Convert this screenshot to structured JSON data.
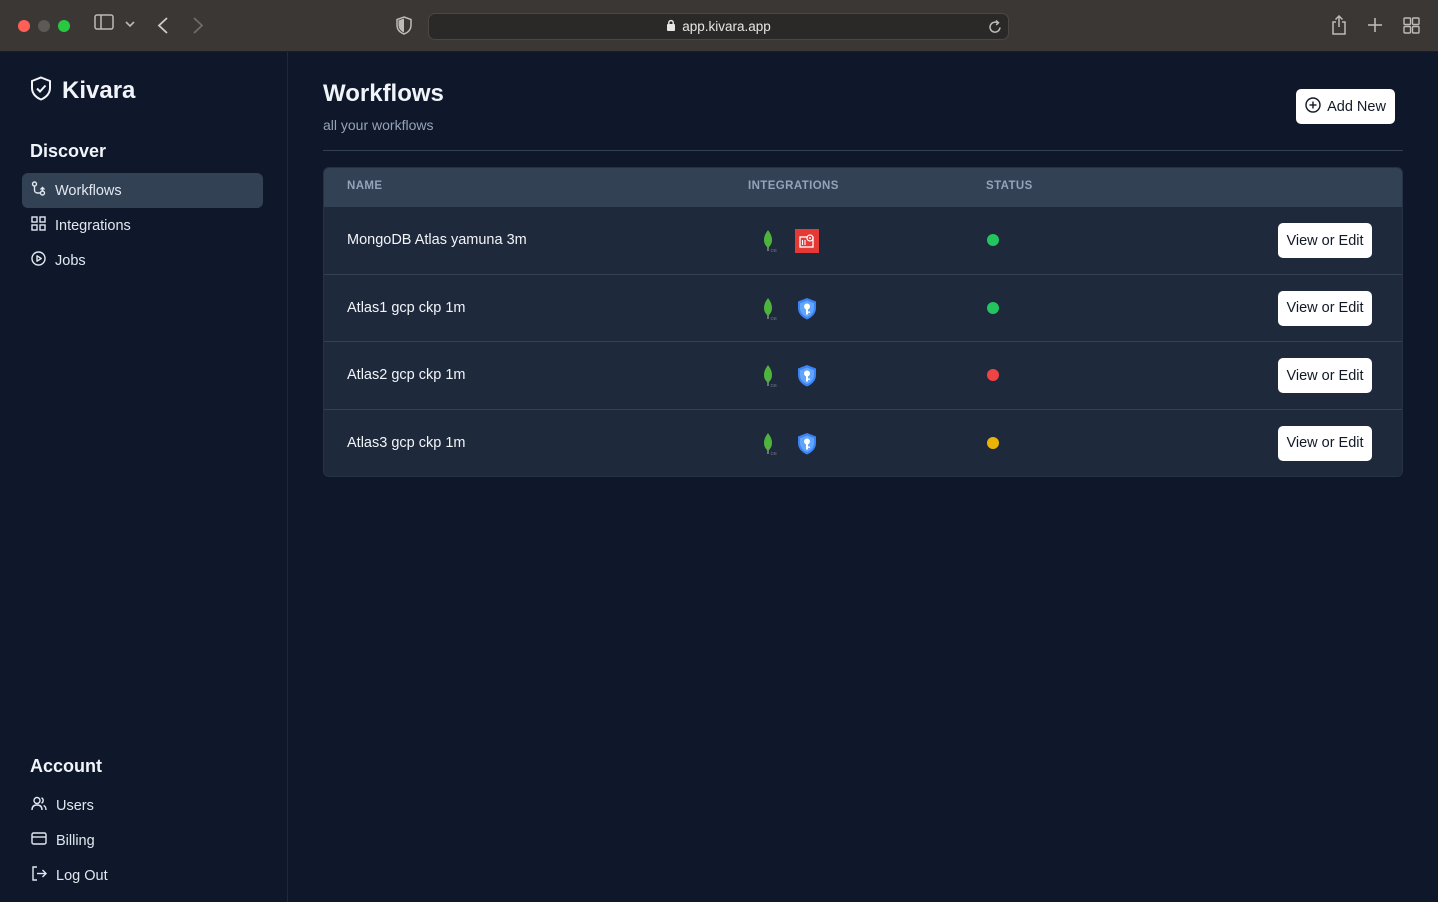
{
  "browser": {
    "url": "app.kivara.app",
    "icons": [
      "sidebar-toggle-icon",
      "chevron-down-icon",
      "back-icon",
      "forward-icon",
      "privacy-shield-icon",
      "lock-icon",
      "reload-icon",
      "share-icon",
      "new-tab-icon",
      "tab-overview-icon"
    ]
  },
  "brand": {
    "name": "Kivara",
    "icon": "shield-check-icon"
  },
  "sidebar": {
    "discover_title": "Discover",
    "discover_items": [
      {
        "label": "Workflows",
        "icon": "workflow-icon",
        "active": true
      },
      {
        "label": "Integrations",
        "icon": "grid-icon",
        "active": false
      },
      {
        "label": "Jobs",
        "icon": "play-circle-icon",
        "active": false
      }
    ],
    "account_title": "Account",
    "account_items": [
      {
        "label": "Users",
        "icon": "users-icon"
      },
      {
        "label": "Billing",
        "icon": "credit-card-icon"
      },
      {
        "label": "Log Out",
        "icon": "logout-icon"
      }
    ]
  },
  "header": {
    "title": "Workflows",
    "subtitle": "all your workflows",
    "add_label": "Add New"
  },
  "table": {
    "columns": {
      "name": "NAME",
      "integrations": "INTEGRATIONS",
      "status": "STATUS"
    },
    "rows": [
      {
        "name": "MongoDB Atlas yamuna 3m",
        "integrations": [
          "mongodb-icon",
          "gcs-bucket-icon"
        ],
        "status": "green",
        "action": "View or Edit"
      },
      {
        "name": "Atlas1 gcp ckp 1m",
        "integrations": [
          "mongodb-icon",
          "key-shield-icon"
        ],
        "status": "green",
        "action": "View or Edit"
      },
      {
        "name": "Atlas2 gcp ckp 1m",
        "integrations": [
          "mongodb-icon",
          "key-shield-icon"
        ],
        "status": "red",
        "action": "View or Edit"
      },
      {
        "name": "Atlas3 gcp ckp 1m",
        "integrations": [
          "mongodb-icon",
          "key-shield-icon"
        ],
        "status": "yellow",
        "action": "View or Edit"
      }
    ]
  },
  "colors": {
    "background": "#0f172a",
    "table_bg": "#1e293b",
    "header_bg": "#334155",
    "status_green": "#22c55e",
    "status_red": "#ef4444",
    "status_yellow": "#eab308",
    "mongodb_green": "#4db33d",
    "gcs_red": "#e53935",
    "key_blue": "#3b82f6"
  }
}
